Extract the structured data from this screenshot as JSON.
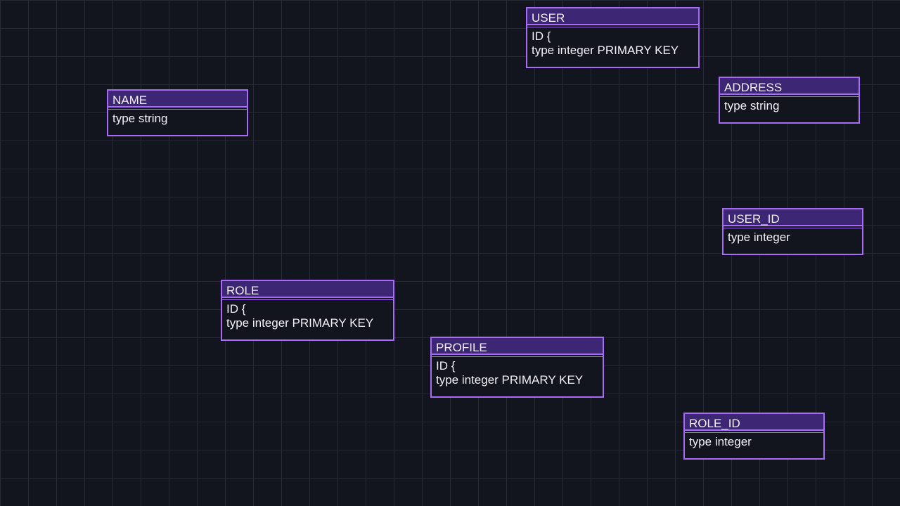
{
  "theme": {
    "background": "#13151e",
    "grid_line": "#272a36",
    "entity_border": "#a66cf5",
    "entity_header": "#3d2775",
    "text": "#f1f1f5"
  },
  "entities": {
    "user": {
      "title": "USER",
      "body": "ID {\ntype integer PRIMARY KEY"
    },
    "address": {
      "title": "ADDRESS",
      "body": "type string"
    },
    "name": {
      "title": "NAME",
      "body": "type string"
    },
    "user_id": {
      "title": "USER_ID",
      "body": "type integer"
    },
    "role": {
      "title": "ROLE",
      "body": "ID {\ntype integer PRIMARY KEY"
    },
    "profile": {
      "title": "PROFILE",
      "body": "ID {\ntype integer PRIMARY KEY"
    },
    "role_id": {
      "title": "ROLE_ID",
      "body": "type integer"
    }
  }
}
